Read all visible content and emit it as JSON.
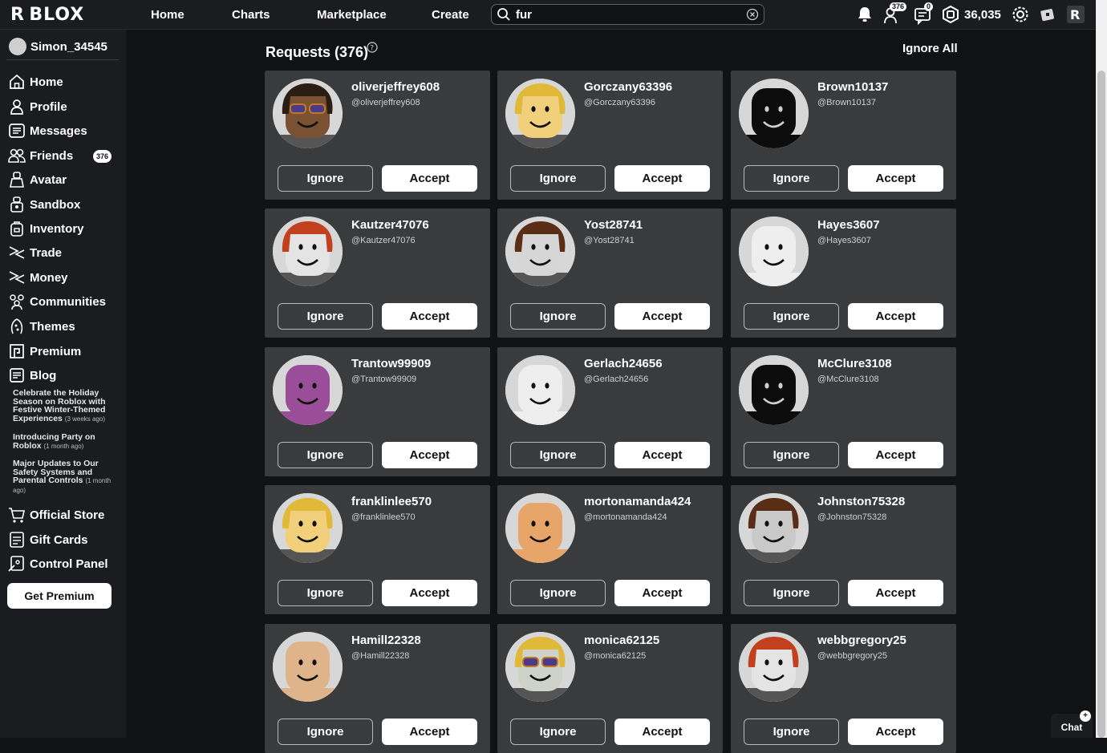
{
  "topbar": {
    "logo": "R BLOX",
    "nav": [
      "Home",
      "Charts",
      "Marketplace",
      "Create"
    ],
    "search_value": "fur",
    "friend_requests_count": "376",
    "messages_count": "0",
    "robux": "36,035"
  },
  "sidebar": {
    "username": "Simon_34545",
    "items": [
      {
        "label": "Home",
        "icon": "home-icon"
      },
      {
        "label": "Profile",
        "icon": "profile-icon"
      },
      {
        "label": "Messages",
        "icon": "messages-icon"
      },
      {
        "label": "Friends",
        "icon": "friends-icon"
      },
      {
        "label": "Avatar",
        "icon": "avatar-icon"
      },
      {
        "label": "Sandbox",
        "icon": "sandbox-icon"
      },
      {
        "label": "Inventory",
        "icon": "inventory-icon"
      },
      {
        "label": "Trade",
        "icon": "trade-icon"
      },
      {
        "label": "Money",
        "icon": "money-icon"
      },
      {
        "label": "Communities",
        "icon": "communities-icon"
      },
      {
        "label": "Themes",
        "icon": "themes-icon"
      },
      {
        "label": "Premium",
        "icon": "premium-icon"
      },
      {
        "label": "Blog",
        "icon": "blog-icon"
      }
    ],
    "friends_badge": "376",
    "blog_posts": [
      {
        "title": "Celebrate the Holiday Season on Roblox with Festive Winter-Themed Experiences",
        "ago": "(3 weeks ago)"
      },
      {
        "title": "Introducing Party on Roblox",
        "ago": "(1 month ago)"
      },
      {
        "title": "Major Updates to Our Safety Systems and Parental Controls",
        "ago": "(1 month ago)"
      }
    ],
    "bottom_items": [
      {
        "label": "Official Store",
        "icon": "store-icon"
      },
      {
        "label": "Gift Cards",
        "icon": "gift-card-icon"
      },
      {
        "label": "Control Panel",
        "icon": "control-panel-icon"
      }
    ],
    "get_premium": "Get Premium"
  },
  "main": {
    "title": "Requests (376)",
    "ignore_all": "Ignore All",
    "ignore_label": "Ignore",
    "accept_label": "Accept",
    "requests": [
      {
        "name": "oliverjeffrey608",
        "handle": "@oliverjeffrey608",
        "skin": "#7a5233",
        "hair": "#2a1d12",
        "glasses": true
      },
      {
        "name": "Gorczany63396",
        "handle": "@Gorczany63396",
        "skin": "#f2cf7a",
        "hair": "#e1b93a",
        "glasses": false
      },
      {
        "name": "Brown10137",
        "handle": "@Brown10137",
        "skin": "#0c0c0c",
        "hair": "#0c0c0c",
        "glasses": false
      },
      {
        "name": "Kautzer47076",
        "handle": "@Kautzer47076",
        "skin": "#e4e4e4",
        "hair": "#c2401d",
        "glasses": false
      },
      {
        "name": "Yost28741",
        "handle": "@Yost28741",
        "skin": "#d6d6d6",
        "hair": "#5a2d16",
        "glasses": false
      },
      {
        "name": "Hayes3607",
        "handle": "@Hayes3607",
        "skin": "#eeeeee",
        "hair": "#eeeeee",
        "glasses": false
      },
      {
        "name": "Trantow99909",
        "handle": "@Trantow99909",
        "skin": "#9a4e9a",
        "hair": "#9a4e9a",
        "glasses": false
      },
      {
        "name": "Gerlach24656",
        "handle": "@Gerlach24656",
        "skin": "#eeeeee",
        "hair": "#eeeeee",
        "glasses": false
      },
      {
        "name": "McClure3108",
        "handle": "@McClure3108",
        "skin": "#0c0c0c",
        "hair": "#0c0c0c",
        "glasses": false
      },
      {
        "name": "franklinlee570",
        "handle": "@franklinlee570",
        "skin": "#f2cf7a",
        "hair": "#e1b93a",
        "glasses": false
      },
      {
        "name": "mortonamanda424",
        "handle": "@mortonamanda424",
        "skin": "#e8a56a",
        "hair": "#e8a56a",
        "glasses": false
      },
      {
        "name": "Johnston75328",
        "handle": "@Johnston75328",
        "skin": "#c9c9c9",
        "hair": "#5a2d16",
        "glasses": false
      },
      {
        "name": "Hamill22328",
        "handle": "@Hamill22328",
        "skin": "#e0b48a",
        "hair": "#e0b48a",
        "glasses": false
      },
      {
        "name": "monica62125",
        "handle": "@monica62125",
        "skin": "#cfd2c8",
        "hair": "#e1b93a",
        "glasses": true
      },
      {
        "name": "webbgregory25",
        "handle": "@webbgregory25",
        "skin": "#e4e4e4",
        "hair": "#c2401d",
        "glasses": false
      }
    ]
  },
  "chat": {
    "label": "Chat"
  }
}
